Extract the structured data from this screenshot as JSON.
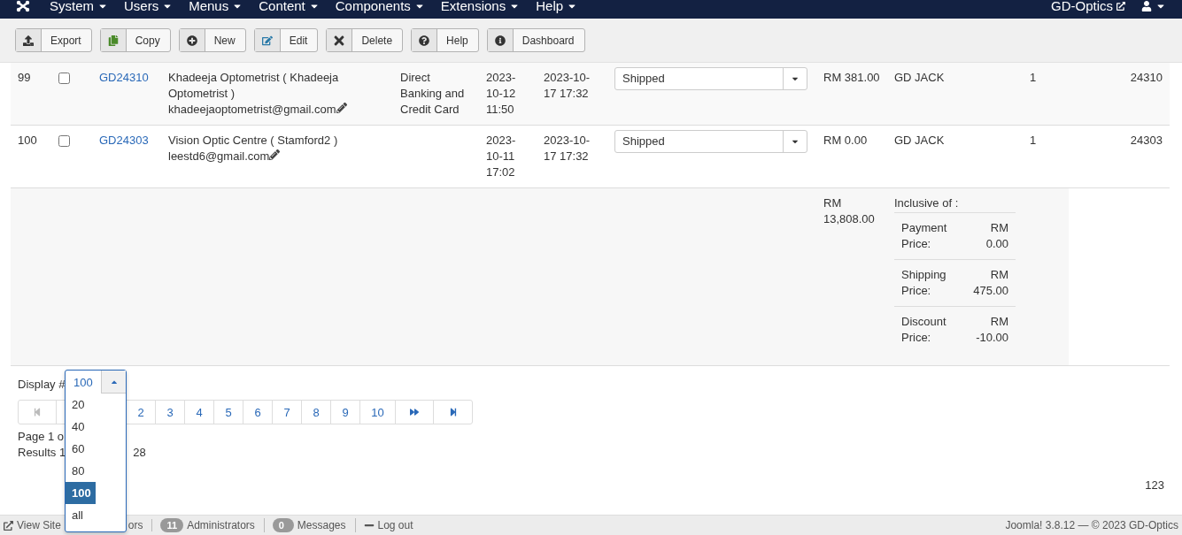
{
  "navbar": {
    "menus": [
      {
        "label": "System"
      },
      {
        "label": "Users"
      },
      {
        "label": "Menus"
      },
      {
        "label": "Content"
      },
      {
        "label": "Components"
      },
      {
        "label": "Extensions"
      },
      {
        "label": "Help"
      }
    ],
    "site_link": "GD-Optics"
  },
  "toolbar": [
    {
      "kind": "export",
      "label": "Export"
    },
    {
      "kind": "copy",
      "label": "Copy"
    },
    {
      "kind": "new",
      "label": "New"
    },
    {
      "kind": "edit",
      "label": "Edit"
    },
    {
      "kind": "delete",
      "label": "Delete"
    },
    {
      "kind": "help",
      "label": "Help"
    },
    {
      "kind": "dashboard",
      "label": "Dashboard"
    }
  ],
  "table": {
    "rows": [
      {
        "number": "99",
        "checked": false,
        "order": "GD24310",
        "customer": "Khadeeja Optometrist ( Khadeeja Optometrist )",
        "email": "khadeejaoptometrist@gmail.com",
        "payment": "Direct Banking and Credit Card",
        "created": "2023-10-12 11:50",
        "modified": "2023-10-17 17:32",
        "status": "Shipped",
        "total": "RM 381.00",
        "user": "GD JACK",
        "qty": "1",
        "id": "24310"
      },
      {
        "number": "100",
        "checked": false,
        "order": "GD24303",
        "customer": "Vision Optic Centre ( Stamford2 )",
        "email": "leestd6@gmail.com",
        "payment": "",
        "created": "2023-10-11 17:02",
        "modified": "2023-10-17 17:32",
        "status": "Shipped",
        "total": "RM 0.00",
        "user": "GD JACK",
        "qty": "1",
        "id": "24303"
      }
    ],
    "totals": {
      "total": "RM 13,808.00",
      "inclusive_label": "Inclusive of :",
      "lines": [
        {
          "label": "Payment Price:",
          "amount": "RM 0.00"
        },
        {
          "label": "Shipping Price:",
          "amount": "RM 475.00"
        },
        {
          "label": "Discount Price:",
          "amount": "RM -10.00"
        }
      ]
    }
  },
  "display": {
    "label": "Display #",
    "value": "100",
    "expanded": true,
    "options": [
      {
        "label": "20",
        "selected": false
      },
      {
        "label": "40",
        "selected": false
      },
      {
        "label": "60",
        "selected": false
      },
      {
        "label": "80",
        "selected": false
      },
      {
        "label": "100",
        "selected": true
      },
      {
        "label": "all",
        "selected": false
      }
    ]
  },
  "pagination": {
    "first_disabled": true,
    "pages": [
      "2",
      "3",
      "4",
      "5",
      "6",
      "7",
      "8",
      "9",
      "10"
    ]
  },
  "page_info": "Page 1 o",
  "results": [
    "Results 1",
    "28"
  ],
  "count": "123",
  "status_bar": {
    "view_site": "View Site",
    "visitors_suffix": "ors",
    "admins_count": "11",
    "admins": "Administrators",
    "messages_count": "0",
    "messages": "Messages",
    "logout": "Log out",
    "version": "Joomla! 3.8.12 — © 2023 GD-Optics"
  }
}
